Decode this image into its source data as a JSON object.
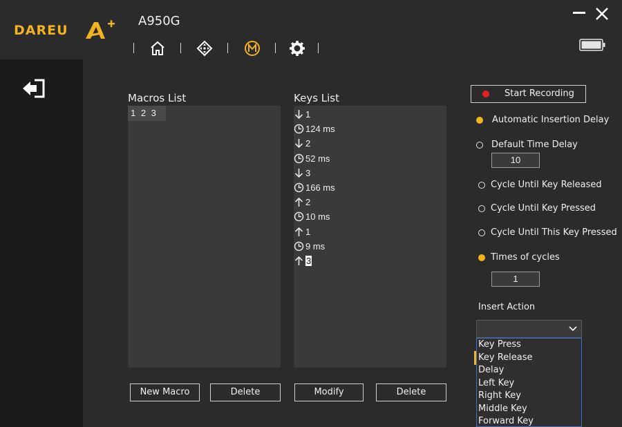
{
  "brand": {
    "logo_text": "DAREU",
    "logo_mark": "A+"
  },
  "device": {
    "model": "A950G"
  },
  "nav": [
    "home-icon",
    "dpad-icon",
    "macro-icon",
    "gear-icon"
  ],
  "colors": {
    "accent": "#f2b320",
    "record": "#e02020",
    "dropdown_border": "#3c6fc4"
  },
  "macros": {
    "title": "Macros List",
    "items": [
      "1 2 3"
    ]
  },
  "keys": {
    "title": "Keys List",
    "items": [
      {
        "icon": "key-down-icon",
        "text": "1"
      },
      {
        "icon": "clock-icon",
        "text": "124 ms"
      },
      {
        "icon": "key-down-icon",
        "text": "2"
      },
      {
        "icon": "clock-icon",
        "text": "52 ms"
      },
      {
        "icon": "key-down-icon",
        "text": "3"
      },
      {
        "icon": "clock-icon",
        "text": "166 ms"
      },
      {
        "icon": "key-up-icon",
        "text": "2"
      },
      {
        "icon": "clock-icon",
        "text": "10 ms"
      },
      {
        "icon": "key-up-icon",
        "text": "1"
      },
      {
        "icon": "clock-icon",
        "text": "9 ms"
      },
      {
        "icon": "key-up-icon",
        "text": "3",
        "selected": true
      }
    ]
  },
  "buttons": {
    "new_macro": "New Macro",
    "delete_macro": "Delete",
    "modify": "Modify",
    "delete_key": "Delete"
  },
  "recording": {
    "label": "Start Recording"
  },
  "delay_options": {
    "auto": {
      "label": "Automatic Insertion Delay",
      "checked": true
    },
    "default": {
      "label": "Default Time Delay",
      "checked": false,
      "value": "10"
    }
  },
  "cycle_options": {
    "until_released": {
      "label": "Cycle Until Key Released",
      "checked": false
    },
    "until_pressed": {
      "label": "Cycle Until Key Pressed",
      "checked": false
    },
    "until_this_pressed": {
      "label": "Cycle Until This Key Pressed",
      "checked": false
    },
    "times": {
      "label": "Times of cycles",
      "checked": true,
      "value": "1"
    }
  },
  "insert_action": {
    "label": "Insert Action",
    "selected": "",
    "options": [
      "Key Press",
      "Key Release",
      "Delay",
      "Left Key",
      "Right Key",
      "Middle Key",
      "Forward Key"
    ]
  }
}
